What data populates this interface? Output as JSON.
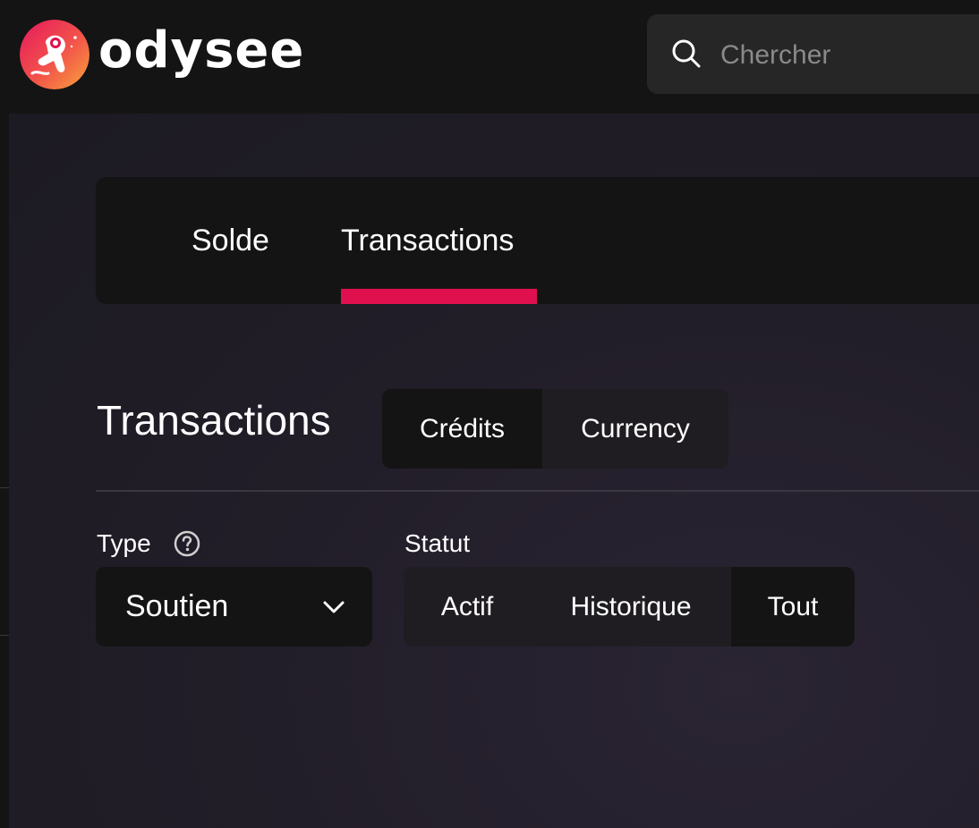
{
  "app": {
    "brand_name": "odysee",
    "accent_color": "#e0104f"
  },
  "search": {
    "placeholder": "Chercher",
    "icon": "search-icon"
  },
  "tabs": [
    {
      "label": "Solde",
      "active": false
    },
    {
      "label": "Transactions",
      "active": true
    }
  ],
  "section": {
    "title": "Transactions",
    "currency_toggle": [
      {
        "label": "Crédits",
        "active": true
      },
      {
        "label": "Currency",
        "active": false
      }
    ]
  },
  "filters": {
    "type": {
      "label": "Type",
      "help_icon": "help-circle-icon",
      "selected": "Soutien"
    },
    "status": {
      "label": "Statut",
      "options": [
        {
          "label": "Actif",
          "active": false
        },
        {
          "label": "Historique",
          "active": false
        },
        {
          "label": "Tout",
          "active": true
        }
      ]
    }
  }
}
